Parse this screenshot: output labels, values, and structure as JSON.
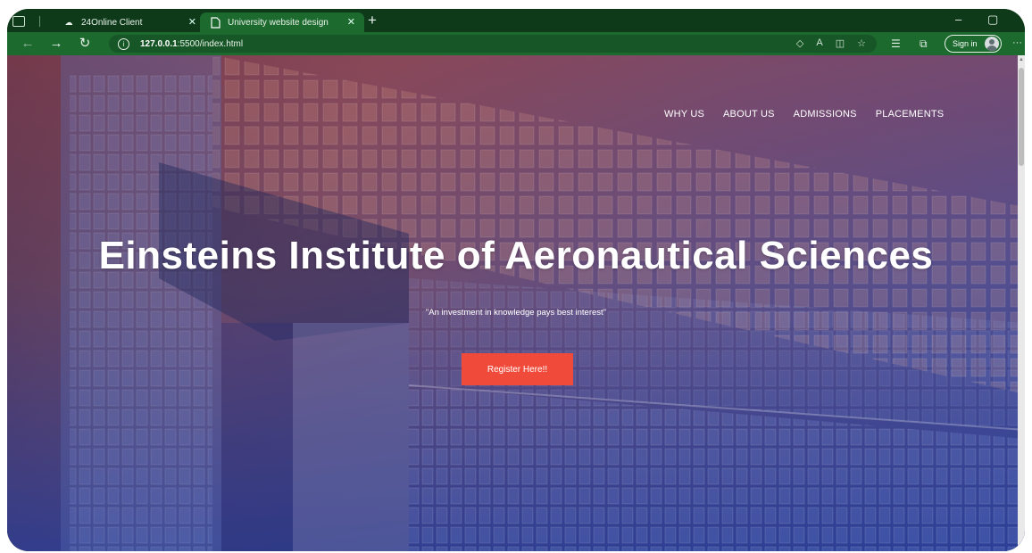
{
  "browser": {
    "tabs": [
      {
        "label": "24Online Client",
        "icon": "cloud-icon",
        "active": false
      },
      {
        "label": "University website design",
        "icon": "page-icon",
        "active": true
      }
    ],
    "url_host": "127.0.0.1",
    "url_rest": ":5500/index.html",
    "sign_in_label": "Sign in",
    "accent": "#1d6a2f"
  },
  "site": {
    "nav": [
      "WHY US",
      "ABOUT US",
      "ADMISSIONS",
      "PLACEMENTS"
    ],
    "title": "Einsteins Institute of Aeronautical Sciences",
    "tagline": "\"An investment in knowledge pays best interest\"",
    "cta_label": "Register Here!!",
    "cta_color": "#f04a3a"
  }
}
